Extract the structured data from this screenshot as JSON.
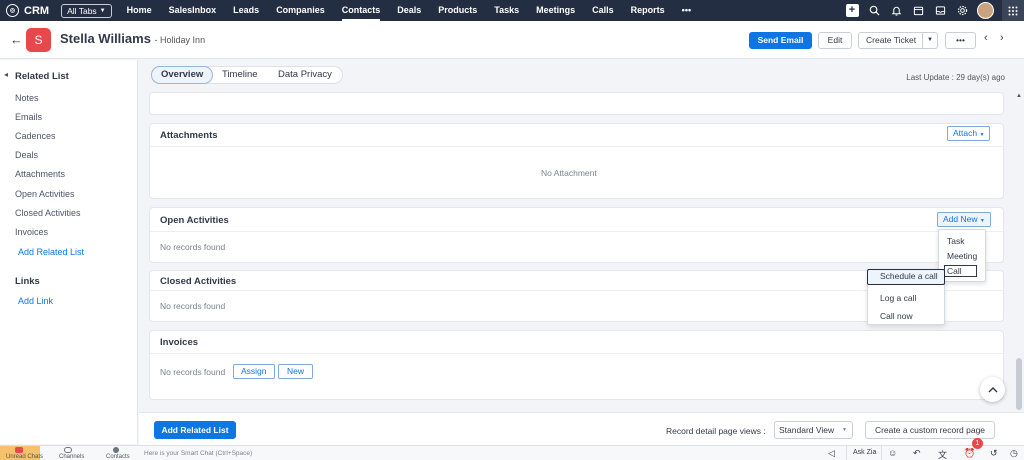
{
  "app": {
    "name": "CRM",
    "all_tabs": "All Tabs"
  },
  "nav": {
    "items": [
      "Home",
      "SalesInbox",
      "Leads",
      "Companies",
      "Contacts",
      "Deals",
      "Products",
      "Tasks",
      "Meetings",
      "Calls",
      "Reports"
    ],
    "more": "•••",
    "active": "Contacts"
  },
  "record": {
    "initial": "S",
    "name": "Stella Williams",
    "company": "- Holiday Inn"
  },
  "actions": {
    "send_email": "Send Email",
    "edit": "Edit",
    "create_ticket": "Create Ticket",
    "more": "•••"
  },
  "sidebar": {
    "related_title": "Related List",
    "items": [
      "Notes",
      "Emails",
      "Cadences",
      "Deals",
      "Attachments",
      "Open Activities",
      "Closed Activities",
      "Invoices"
    ],
    "add_related": "Add Related List",
    "links_title": "Links",
    "add_link": "Add Link"
  },
  "tabs": {
    "overview": "Overview",
    "timeline": "Timeline",
    "privacy": "Data Privacy"
  },
  "last_update": "Last Update : 29 day(s) ago",
  "attachments": {
    "title": "Attachments",
    "attach": "Attach",
    "empty": "No Attachment"
  },
  "open_activities": {
    "title": "Open Activities",
    "add_new": "Add New",
    "empty": "No records found"
  },
  "add_new_menu": {
    "task": "Task",
    "meeting": "Meeting",
    "call": "Call"
  },
  "call_menu": {
    "schedule": "Schedule a call",
    "log": "Log a call",
    "now": "Call now"
  },
  "closed_activities": {
    "title": "Closed Activities",
    "empty": "No records found"
  },
  "invoices": {
    "title": "Invoices",
    "empty": "No records found",
    "assign": "Assign",
    "new": "New"
  },
  "footer": {
    "add_related": "Add Related List",
    "views_label": "Record detail page views :",
    "view_value": "Standard View",
    "custom": "Create a custom record page"
  },
  "bottom": {
    "unread": "Unread Chats",
    "channels": "Channels",
    "contacts": "Contacts",
    "smartchat": "Here is your Smart Chat (Ctrl+Space)",
    "ask_zia": "Ask Zia",
    "badge": "1"
  },
  "colors": {
    "nav_bg": "#242e42",
    "primary": "#0e76e3",
    "badge_red": "#e8474c"
  }
}
